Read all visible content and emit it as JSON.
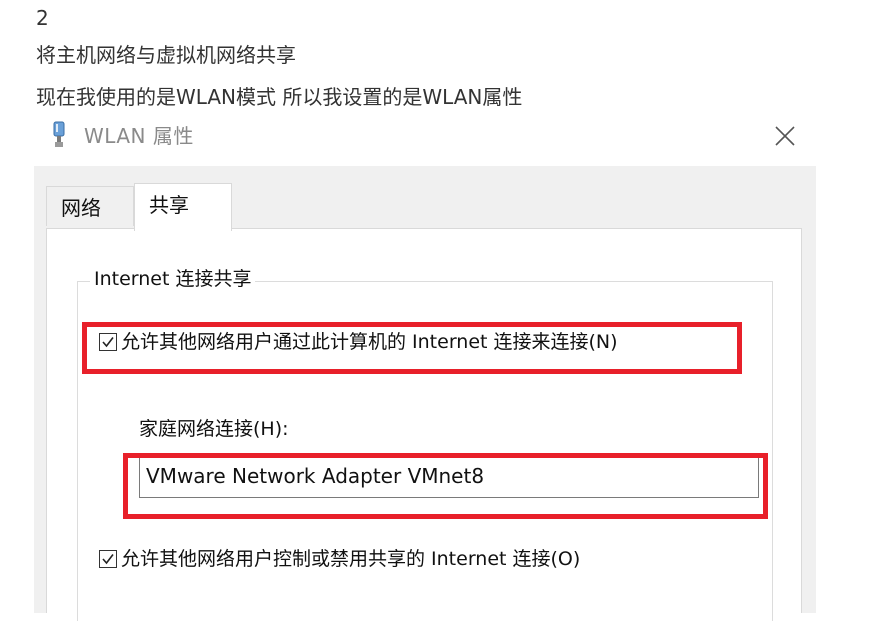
{
  "article": {
    "number": "2",
    "line1": "将主机网络与虚拟机网络共享",
    "line2": "现在我使用的是WLAN模式 所以我设置的是WLAN属性"
  },
  "dialog": {
    "title": "WLAN 属性",
    "tabs": [
      {
        "label": "网络",
        "active": false
      },
      {
        "label": "共享",
        "active": true
      }
    ],
    "group_title": "Internet 连接共享",
    "allow_share": {
      "label": "允许其他网络用户通过此计算机的 Internet 连接来连接(N)",
      "checked": true
    },
    "home_connection": {
      "label": "家庭网络连接(H):",
      "value": "VMware Network Adapter VMnet8"
    },
    "allow_control": {
      "label": "允许其他网络用户控制或禁用共享的 Internet 连接(O)",
      "checked": true
    }
  },
  "colors": {
    "highlight": "#e8202a",
    "dialog_bg": "#f0f0f0",
    "title_text": "#8a8a8a"
  },
  "icons": {
    "title": "network-adapter-icon",
    "close": "close-icon",
    "check": "checkmark-icon"
  }
}
